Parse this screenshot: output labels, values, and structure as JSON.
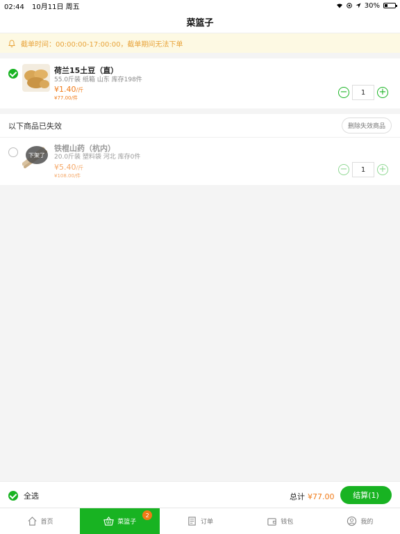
{
  "status_bar": {
    "time": "02:44",
    "date": "10月11日 周五",
    "battery": "30%",
    "battery_level": 0.3
  },
  "nav": {
    "title": "菜篮子"
  },
  "notice": {
    "text": "截单时间：00:00:00-17:00:00，截单期间无法下单"
  },
  "cart_items": [
    {
      "name": "荷兰15土豆（直）",
      "spec": "55.0斤装  纸箱  山东  库存198件",
      "price": "¥1.40",
      "price_unit": "/斤",
      "unit_price": "¥77.00/件",
      "qty": "1",
      "checked": true
    }
  ],
  "invalid_section": {
    "title": "以下商品已失效",
    "delete_label": "删除失效商品"
  },
  "invalid_items": [
    {
      "name": "铁棍山药（杭内）",
      "spec": "20.0斤装  塑料袋  河北  库存0件",
      "price": "¥5.40",
      "price_unit": "/斤",
      "unit_price": "¥108.00/件",
      "qty": "1",
      "badge": "下架了"
    }
  ],
  "bottom_bar": {
    "select_all": "全选",
    "total_label": "总计",
    "total_value": "¥77.00",
    "checkout": "结算(1)"
  },
  "tabs": [
    {
      "label": "首页",
      "icon": "home-icon"
    },
    {
      "label": "菜篮子",
      "icon": "basket-icon",
      "badge": "2",
      "active": true
    },
    {
      "label": "订单",
      "icon": "order-icon"
    },
    {
      "label": "钱包",
      "icon": "wallet-icon"
    },
    {
      "label": "我的",
      "icon": "profile-icon"
    }
  ],
  "colors": {
    "accent": "#18b322",
    "price": "#f07a17",
    "notice_bg": "#fdf9e3",
    "notice_text": "#e8a33a"
  }
}
